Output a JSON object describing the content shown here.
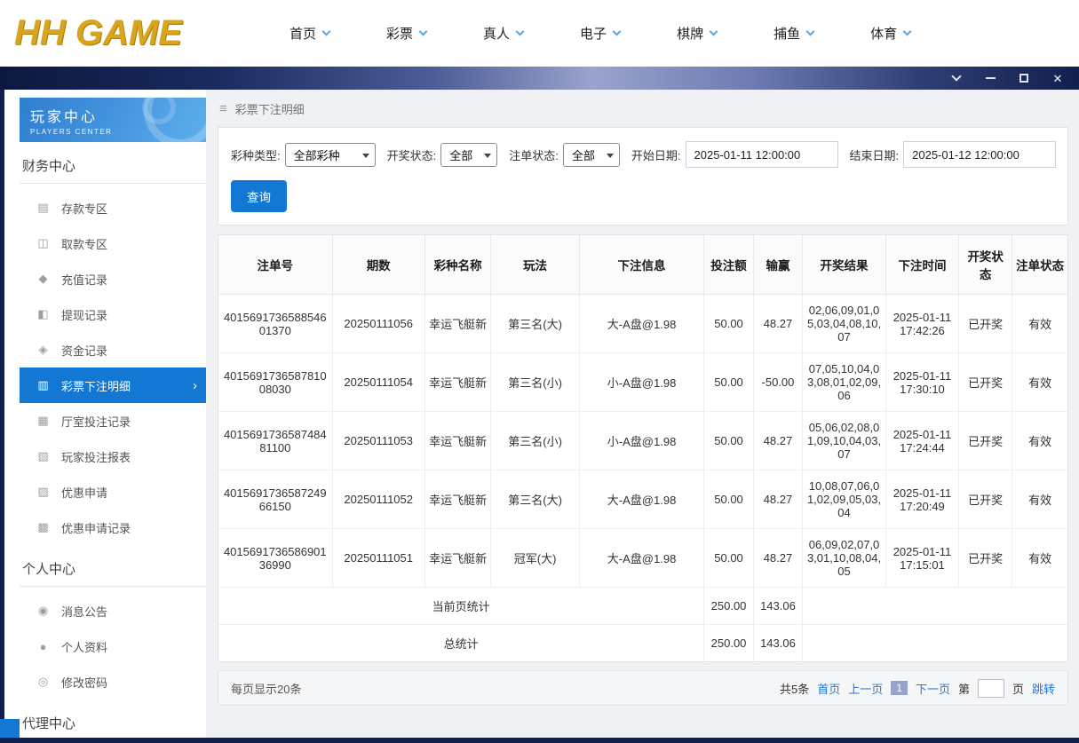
{
  "brand": {
    "logo_text": "HH GAME"
  },
  "top_nav": {
    "items": [
      "首页",
      "彩票",
      "真人",
      "电子",
      "棋牌",
      "捕鱼",
      "体育"
    ]
  },
  "titlebar": {
    "icons": [
      "chevron-down-icon",
      "minimize-icon",
      "maximize-icon",
      "close-icon"
    ]
  },
  "sidebar": {
    "title": "玩家中心",
    "subtitle": "PLAYERS CENTER",
    "sections": [
      {
        "title": "财务中心",
        "items": [
          {
            "label": "存款专区",
            "icon": "deposit-icon",
            "glyph": "▤"
          },
          {
            "label": "取款专区",
            "icon": "withdraw-icon",
            "glyph": "◫"
          },
          {
            "label": "充值记录",
            "icon": "recharge-record-icon",
            "glyph": "◆"
          },
          {
            "label": "提现记录",
            "icon": "withdrawal-record-icon",
            "glyph": "◧"
          },
          {
            "label": "资金记录",
            "icon": "funds-record-icon",
            "glyph": "◈"
          },
          {
            "label": "彩票下注明细",
            "icon": "lottery-bet-detail-icon",
            "glyph": "▥",
            "active": true
          },
          {
            "label": "厅室投注记录",
            "icon": "hall-bet-record-icon",
            "glyph": "▦"
          },
          {
            "label": "玩家投注报表",
            "icon": "player-bet-report-icon",
            "glyph": "▧"
          },
          {
            "label": "优惠申请",
            "icon": "promo-apply-icon",
            "glyph": "▨"
          },
          {
            "label": "优惠申请记录",
            "icon": "promo-apply-record-icon",
            "glyph": "▩"
          }
        ]
      },
      {
        "title": "个人中心",
        "items": [
          {
            "label": "消息公告",
            "icon": "announcement-icon",
            "glyph": "◉"
          },
          {
            "label": "个人资料",
            "icon": "profile-icon",
            "glyph": "●"
          },
          {
            "label": "修改密码",
            "icon": "password-icon",
            "glyph": "◎"
          }
        ]
      },
      {
        "title": "代理中心",
        "items": []
      }
    ]
  },
  "main": {
    "breadcrumb": "彩票下注明细",
    "filters": {
      "lottery_type": {
        "label": "彩种类型:",
        "value": "全部彩种"
      },
      "draw_status": {
        "label": "开奖状态:",
        "value": "全部"
      },
      "order_status": {
        "label": "注单状态:",
        "value": "全部"
      },
      "start_date": {
        "label": "开始日期:",
        "value": "2025-01-11 12:00:00"
      },
      "end_date": {
        "label": "结束日期:",
        "value": "2025-01-12 12:00:00"
      },
      "query_button": "查询"
    },
    "table": {
      "headers": [
        "注单号",
        "期数",
        "彩种名称",
        "玩法",
        "下注信息",
        "投注额",
        "输赢",
        "开奖结果",
        "下注时间",
        "开奖状态",
        "注单状态"
      ],
      "keys": [
        "order_no",
        "period",
        "lottery",
        "play",
        "bet_info",
        "amount",
        "winloss",
        "result",
        "time",
        "draw_status",
        "order_status"
      ],
      "rows": [
        {
          "order_no": "401569173658854601370",
          "period": "20250111056",
          "lottery": "幸运飞艇新",
          "play": "第三名(大)",
          "bet_info": "大-A盘@1.98",
          "amount": "50.00",
          "winloss": "48.27",
          "result": "02,06,09,01,05,03,04,08,10,07",
          "time": "2025-01-11 17:42:26",
          "draw_status": "已开奖",
          "order_status": "有效"
        },
        {
          "order_no": "401569173658781008030",
          "period": "20250111054",
          "lottery": "幸运飞艇新",
          "play": "第三名(小)",
          "bet_info": "小-A盘@1.98",
          "amount": "50.00",
          "winloss": "-50.00",
          "result": "07,05,10,04,03,08,01,02,09,06",
          "time": "2025-01-11 17:30:10",
          "draw_status": "已开奖",
          "order_status": "有效"
        },
        {
          "order_no": "401569173658748481100",
          "period": "20250111053",
          "lottery": "幸运飞艇新",
          "play": "第三名(小)",
          "bet_info": "小-A盘@1.98",
          "amount": "50.00",
          "winloss": "48.27",
          "result": "05,06,02,08,01,09,10,04,03,07",
          "time": "2025-01-11 17:24:44",
          "draw_status": "已开奖",
          "order_status": "有效"
        },
        {
          "order_no": "401569173658724966150",
          "period": "20250111052",
          "lottery": "幸运飞艇新",
          "play": "第三名(大)",
          "bet_info": "大-A盘@1.98",
          "amount": "50.00",
          "winloss": "48.27",
          "result": "10,08,07,06,01,02,09,05,03,04",
          "time": "2025-01-11 17:20:49",
          "draw_status": "已开奖",
          "order_status": "有效"
        },
        {
          "order_no": "401569173658690136990",
          "period": "20250111051",
          "lottery": "幸运飞艇新",
          "play": "冠军(大)",
          "bet_info": "大-A盘@1.98",
          "amount": "50.00",
          "winloss": "48.27",
          "result": "06,09,02,07,03,01,10,08,04,05",
          "time": "2025-01-11 17:15:01",
          "draw_status": "已开奖",
          "order_status": "有效"
        }
      ],
      "summary": [
        {
          "label": "当前页统计",
          "amount": "250.00",
          "winloss": "143.06"
        },
        {
          "label": "总统计",
          "amount": "250.00",
          "winloss": "143.06"
        }
      ]
    },
    "pagination": {
      "page_size": "每页显示20条",
      "total": "共5条",
      "first": "首页",
      "prev": "上一页",
      "current": "1",
      "next": "下一页",
      "jump_prefix": "第",
      "jump_suffix": "页",
      "jump": "跳转"
    }
  },
  "colors": {
    "accent": "#1377d4",
    "link": "#2277d4",
    "frame": "#0f1f4e",
    "gold": "#d8a51f"
  }
}
